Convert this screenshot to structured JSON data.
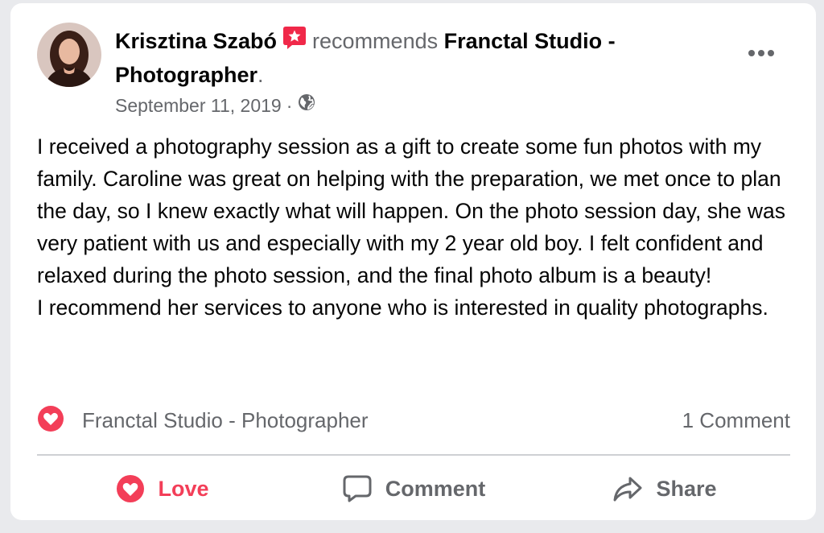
{
  "post": {
    "author": "Krisztina Szabó",
    "recommends_text": "recommends",
    "page_name": "Franctal Studio - Photographer",
    "period": ".",
    "date": "September 11, 2019",
    "separator": "·",
    "audience_icon": "globe-icon",
    "body": "I received a photography session as a gift to create some fun photos with my family. Caroline was great on helping with the preparation, we met once to plan the day, so I knew exactly what will happen. On the photo session day, she was very patient with us and especially with my 2 year old boy. I felt confident and relaxed during the photo session, and the final photo album is a beauty!\nI recommend her services to anyone who is interested in quality photographs."
  },
  "reactions": {
    "icon": "love-reaction-icon",
    "reactor": "Franctal Studio - Photographer",
    "comment_count": "1 Comment"
  },
  "actions": {
    "love_label": "Love",
    "comment_label": "Comment",
    "share_label": "Share"
  },
  "colors": {
    "love": "#f33e58",
    "muted": "#65676b",
    "text": "#050505",
    "badge": "#f02849"
  }
}
